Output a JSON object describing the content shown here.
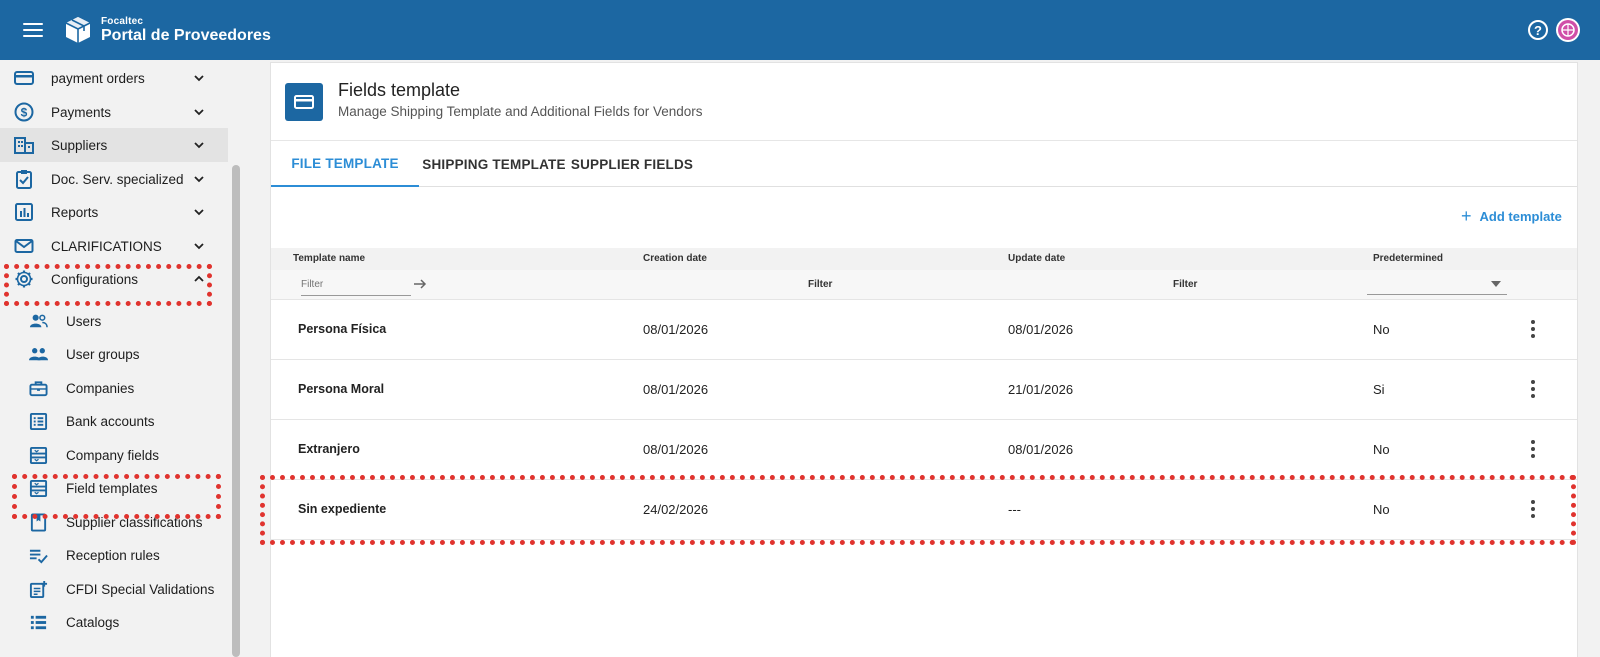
{
  "app": {
    "brand_small": "Focaltec",
    "brand_big": "Portal de Proveedores"
  },
  "sidebar": {
    "items": [
      {
        "label": "payment orders",
        "icon": "card-icon",
        "active": false
      },
      {
        "label": "Payments",
        "icon": "dollar-circle-icon",
        "active": false
      },
      {
        "label": "Suppliers",
        "icon": "building-icon",
        "active": true
      },
      {
        "label": "Doc. Serv. specialized",
        "icon": "clipboard-check-icon",
        "active": false
      },
      {
        "label": "Reports",
        "icon": "bar-chart-icon",
        "active": false
      },
      {
        "label": "CLARIFICATIONS",
        "icon": "mail-icon",
        "active": false
      },
      {
        "label": "Configurations",
        "icon": "gear-icon",
        "active": false
      }
    ],
    "subitems": [
      {
        "label": "Users",
        "icon": "users-icon"
      },
      {
        "label": "User groups",
        "icon": "user-group-icon"
      },
      {
        "label": "Companies",
        "icon": "briefcase-icon"
      },
      {
        "label": "Bank accounts",
        "icon": "list-box-icon"
      },
      {
        "label": "Company fields",
        "icon": "fields-icon"
      },
      {
        "label": "Field templates",
        "icon": "fields-icon"
      },
      {
        "label": "Supplier classifications",
        "icon": "bookmark-icon"
      },
      {
        "label": "Reception rules",
        "icon": "checklist-icon"
      },
      {
        "label": "CFDI Special Validations",
        "icon": "doc-plus-icon"
      },
      {
        "label": "Catalogs",
        "icon": "catalog-list-icon"
      }
    ]
  },
  "page": {
    "title": "Fields template",
    "subtitle": "Manage Shipping Template and Additional Fields for Vendors"
  },
  "tabs": [
    {
      "label": "FILE TEMPLATE",
      "active": true
    },
    {
      "label": "SHIPPING TEMPLATE",
      "active": false
    },
    {
      "label": "SUPPLIER FIELDS",
      "active": false
    }
  ],
  "actions": {
    "add_template": "Add template"
  },
  "table": {
    "columns": [
      "Template name",
      "Creation date",
      "Update date",
      "Predetermined"
    ],
    "filter_placeholder": "Filter",
    "filter_creation": "Filter",
    "filter_update": "Filter",
    "rows": [
      {
        "name": "Persona Física",
        "created": "08/01/2026",
        "updated": "08/01/2026",
        "predetermined": "No"
      },
      {
        "name": "Persona Moral",
        "created": "08/01/2026",
        "updated": "21/01/2026",
        "predetermined": "Si"
      },
      {
        "name": "Extranjero",
        "created": "08/01/2026",
        "updated": "08/01/2026",
        "predetermined": "No"
      },
      {
        "name": "Sin expediente",
        "created": "24/02/2026",
        "updated": "---",
        "predetermined": "No"
      }
    ]
  },
  "colors": {
    "primary": "#1c67a2",
    "accent": "#2c8dd6",
    "highlight": "#e0332e"
  }
}
